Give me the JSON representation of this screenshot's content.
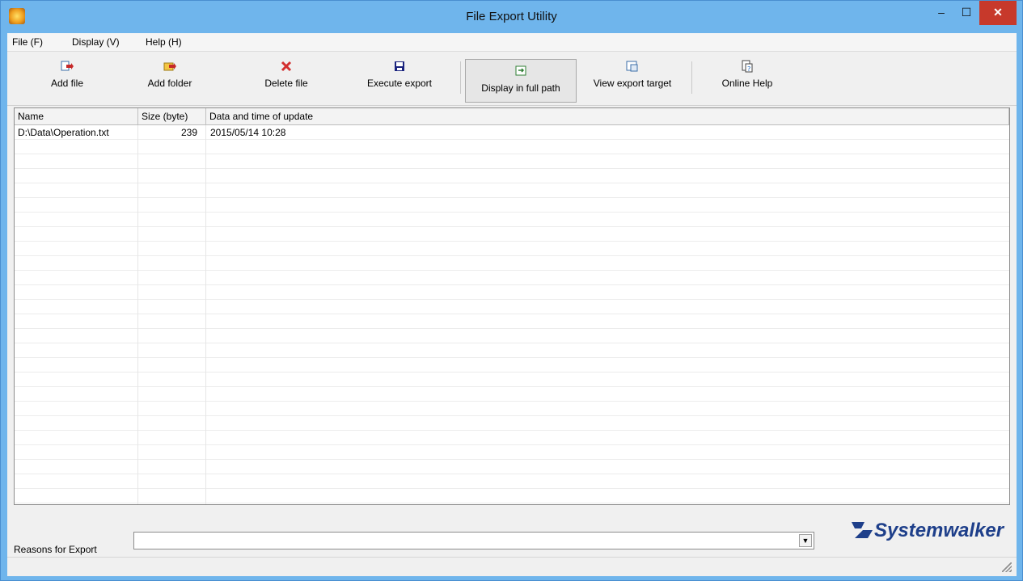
{
  "window": {
    "title": "File Export Utility",
    "minimize": "–",
    "maximize": "☐",
    "close": "✕"
  },
  "menu": {
    "items": [
      {
        "label": "File (F)"
      },
      {
        "label": "Display (V)"
      },
      {
        "label": "Help (H)"
      }
    ]
  },
  "toolbar": {
    "buttons": [
      {
        "label": "Add file",
        "icon": "add-file-icon"
      },
      {
        "label": "Add folder",
        "icon": "add-folder-icon"
      },
      {
        "label": "Delete file",
        "icon": "delete-icon"
      },
      {
        "label": "Execute export",
        "icon": "save-icon"
      },
      {
        "label": "Display in full path",
        "icon": "full-path-icon",
        "pressed": true
      },
      {
        "label": "View export target",
        "icon": "view-target-icon"
      },
      {
        "label": "Online Help",
        "icon": "help-icon"
      }
    ]
  },
  "list": {
    "columns": [
      "Name",
      "Size (byte)",
      "Data and time of update"
    ],
    "rows": [
      {
        "name": "D:\\Data\\Operation.txt",
        "size": "239",
        "updated": "2015/05/14 10:28"
      }
    ]
  },
  "export": {
    "reason_label": "Reasons for Export",
    "reason_value": ""
  },
  "logo": {
    "text": "Systemwalker"
  },
  "colors": {
    "titlebar": "#6fb5ec",
    "close": "#c7392b",
    "logo": "#1e3f8a"
  }
}
